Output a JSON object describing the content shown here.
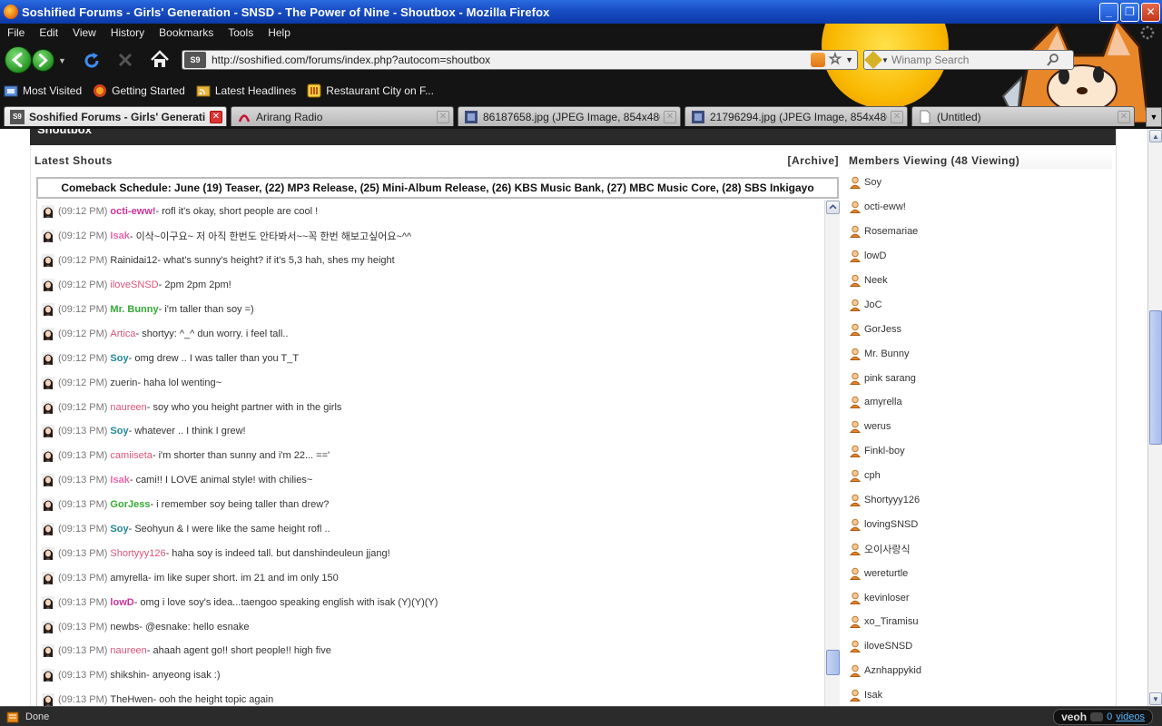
{
  "window": {
    "title": "Soshified Forums - Girls' Generation - SNSD - The Power of Nine - Shoutbox - Mozilla Firefox",
    "minimize": "_",
    "maximize": "❐",
    "close": "✕"
  },
  "menu": [
    "File",
    "Edit",
    "View",
    "History",
    "Bookmarks",
    "Tools",
    "Help"
  ],
  "navbar": {
    "url": "http://soshified.com/forums/index.php?autocom=shoutbox",
    "site_icon": "S9",
    "search_placeholder": "Winamp Search"
  },
  "bookmarks": [
    {
      "label": "Most Visited",
      "icon": "bookmark-folder-icon"
    },
    {
      "label": "Getting Started",
      "icon": "firefox-icon"
    },
    {
      "label": "Latest Headlines",
      "icon": "rss-folder-icon"
    },
    {
      "label": "Restaurant City on F...",
      "icon": "restaurant-city-icon"
    }
  ],
  "tabs": [
    {
      "label": "Soshified Forums - Girls' Generati...",
      "active": true
    },
    {
      "label": "Arirang Radio",
      "active": false
    },
    {
      "label": "86187658.jpg (JPEG Image, 854x480 p...",
      "active": false
    },
    {
      "label": "21796294.jpg (JPEG Image, 854x480 p...",
      "active": false
    },
    {
      "label": "(Untitled)",
      "active": false
    }
  ],
  "shoutbox": {
    "header": "Shoutbox",
    "latest_title": "Latest Shouts",
    "archive": "[Archive]",
    "announcement": "Comeback Schedule: June (19) Teaser, (22) MP3 Release, (25) Mini-Album Release, (26) KBS Music Bank, (27) MBC Music Core, (28) SBS Inkigayo",
    "shouts": [
      {
        "time": "(09:12 PM)",
        "name": "octi-eww!",
        "color": "#cc3399",
        "bold": true,
        "msg": " - rofl it's okay, short people are cool !"
      },
      {
        "time": "(09:12 PM)",
        "name": "Isak",
        "color": "#ee66aa",
        "bold": true,
        "msg": " - 이삭~이구요~ 저 아직 한번도 안타봐서~~꼭 한번 해보고싶어요~^^"
      },
      {
        "time": "(09:12 PM)",
        "name": "Rainidai12",
        "color": "#333333",
        "bold": false,
        "msg": " - what's sunny's height? if it's 5,3 hah, shes my height"
      },
      {
        "time": "(09:12 PM)",
        "name": "iloveSNSD",
        "color": "#dd5577",
        "bold": false,
        "msg": " - 2pm 2pm 2pm!"
      },
      {
        "time": "(09:12 PM)",
        "name": "Mr. Bunny",
        "color": "#33aa33",
        "bold": true,
        "msg": " - i'm taller than soy =)"
      },
      {
        "time": "(09:12 PM)",
        "name": "Artica",
        "color": "#dd5577",
        "bold": false,
        "msg": " - shortyy: ^_^ dun worry. i feel tall.."
      },
      {
        "time": "(09:12 PM)",
        "name": "Soy",
        "color": "#228899",
        "bold": true,
        "msg": " - omg drew .. I was taller than you T_T"
      },
      {
        "time": "(09:12 PM)",
        "name": "zuerin",
        "color": "#333333",
        "bold": false,
        "msg": " - haha lol wenting~"
      },
      {
        "time": "(09:12 PM)",
        "name": "naureen",
        "color": "#dd5577",
        "bold": false,
        "msg": " - soy who you height partner with in the girls"
      },
      {
        "time": "(09:13 PM)",
        "name": "Soy",
        "color": "#228899",
        "bold": true,
        "msg": " - whatever .. I think I grew!"
      },
      {
        "time": "(09:13 PM)",
        "name": "camiiseta",
        "color": "#dd5577",
        "bold": false,
        "msg": " - i'm shorter than sunny and i'm 22... =='"
      },
      {
        "time": "(09:13 PM)",
        "name": "Isak",
        "color": "#ee66aa",
        "bold": true,
        "msg": " - cami!! I LOVE animal style! with chilies~"
      },
      {
        "time": "(09:13 PM)",
        "name": "GorJess",
        "color": "#33aa33",
        "bold": true,
        "msg": " - i remember soy being taller than drew?"
      },
      {
        "time": "(09:13 PM)",
        "name": "Soy",
        "color": "#228899",
        "bold": true,
        "msg": " - Seohyun & I were like the same height rofl .."
      },
      {
        "time": "(09:13 PM)",
        "name": "Shortyyy126",
        "color": "#dd5577",
        "bold": false,
        "msg": " - haha soy is indeed tall. but danshindeuleun jjang!"
      },
      {
        "time": "(09:13 PM)",
        "name": "amyrella",
        "color": "#333333",
        "bold": false,
        "msg": " - im like super short. im 21 and im only 150"
      },
      {
        "time": "(09:13 PM)",
        "name": "lowD",
        "color": "#cc3399",
        "bold": true,
        "msg": " - omg i love soy's idea...taengoo speaking english with isak (Y)(Y)(Y)"
      },
      {
        "time": "(09:13 PM)",
        "name": "newbs",
        "color": "#333333",
        "bold": false,
        "msg": " - @esnake: hello esnake"
      },
      {
        "time": "(09:13 PM)",
        "name": "naureen",
        "color": "#dd5577",
        "bold": false,
        "msg": " - ahaah agent go!! short people!! high five"
      },
      {
        "time": "(09:13 PM)",
        "name": "shikshin",
        "color": "#333333",
        "bold": false,
        "msg": " - anyeong isak :)"
      },
      {
        "time": "(09:13 PM)",
        "name": "TheHwen",
        "color": "#333333",
        "bold": false,
        "msg": " - ooh the height topic again"
      }
    ]
  },
  "members": {
    "title": "Members Viewing (48 Viewing)",
    "list": [
      "Soy",
      "octi-eww!",
      "Rosemariae",
      "lowD",
      "Neek",
      "JoC",
      "GorJess",
      "Mr. Bunny",
      "pink sarang",
      "amyrella",
      "werus",
      "Finkl-boy",
      "cph",
      "Shortyyy126",
      "lovingSNSD",
      "오이사랑식",
      "wereturtle",
      "kevinloser",
      "xo_Tiramisu",
      "iloveSNSD",
      "Aznhappykid",
      "Isak"
    ]
  },
  "status": {
    "text": "Done",
    "veoh_logo": "veoh",
    "veoh_count": "0",
    "veoh_label": "videos"
  }
}
